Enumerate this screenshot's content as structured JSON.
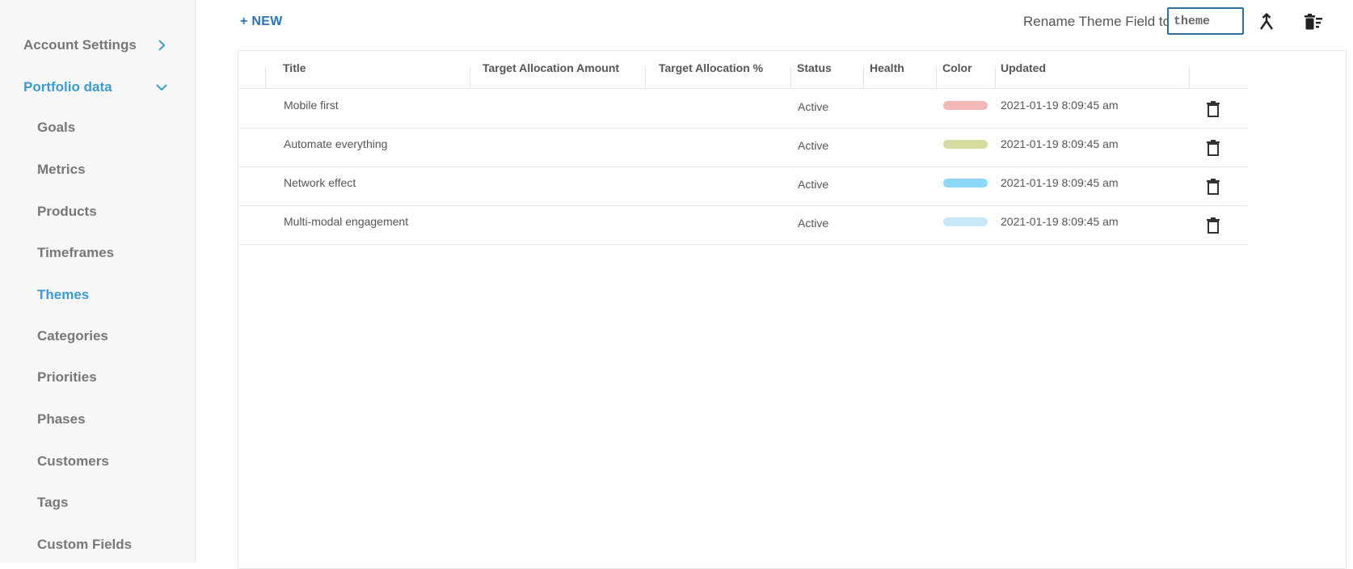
{
  "sidebar": {
    "sections": [
      {
        "label": "Account Settings",
        "expanded": false
      },
      {
        "label": "Portfolio data",
        "expanded": true
      }
    ],
    "items": [
      {
        "label": "Goals"
      },
      {
        "label": "Metrics"
      },
      {
        "label": "Products"
      },
      {
        "label": "Timeframes"
      },
      {
        "label": "Themes",
        "active": true
      },
      {
        "label": "Categories"
      },
      {
        "label": "Priorities"
      },
      {
        "label": "Phases"
      },
      {
        "label": "Customers"
      },
      {
        "label": "Tags"
      },
      {
        "label": "Custom Fields"
      }
    ]
  },
  "toolbar": {
    "new_label": "+ NEW",
    "rename_label": "Rename Theme Field to",
    "rename_value": "theme",
    "merge_icon": "merge-icon",
    "bulk_delete_icon": "bulk-delete-icon"
  },
  "table": {
    "columns": [
      "Title",
      "Target Allocation Amount",
      "Target Allocation %",
      "Status",
      "Health",
      "Color",
      "Updated"
    ],
    "rows": [
      {
        "title": "Mobile first",
        "amount": "",
        "percent": "",
        "status": "Active",
        "health": "",
        "color": "#f4b6b6",
        "updated": "2021-01-19 8:09:45 am"
      },
      {
        "title": "Automate everything",
        "amount": "",
        "percent": "",
        "status": "Active",
        "health": "",
        "color": "#d6dca0",
        "updated": "2021-01-19 8:09:45 am"
      },
      {
        "title": "Network effect",
        "amount": "",
        "percent": "",
        "status": "Active",
        "health": "",
        "color": "#8dd8f6",
        "updated": "2021-01-19 8:09:45 am"
      },
      {
        "title": "Multi-modal engagement",
        "amount": "",
        "percent": "",
        "status": "Active",
        "health": "",
        "color": "#c9e8f7",
        "updated": "2021-01-19 8:09:45 am"
      }
    ]
  },
  "colors": {
    "accent": "#3c9bd0",
    "new_button": "#2a73b5",
    "input_border": "#2b6f9f"
  }
}
